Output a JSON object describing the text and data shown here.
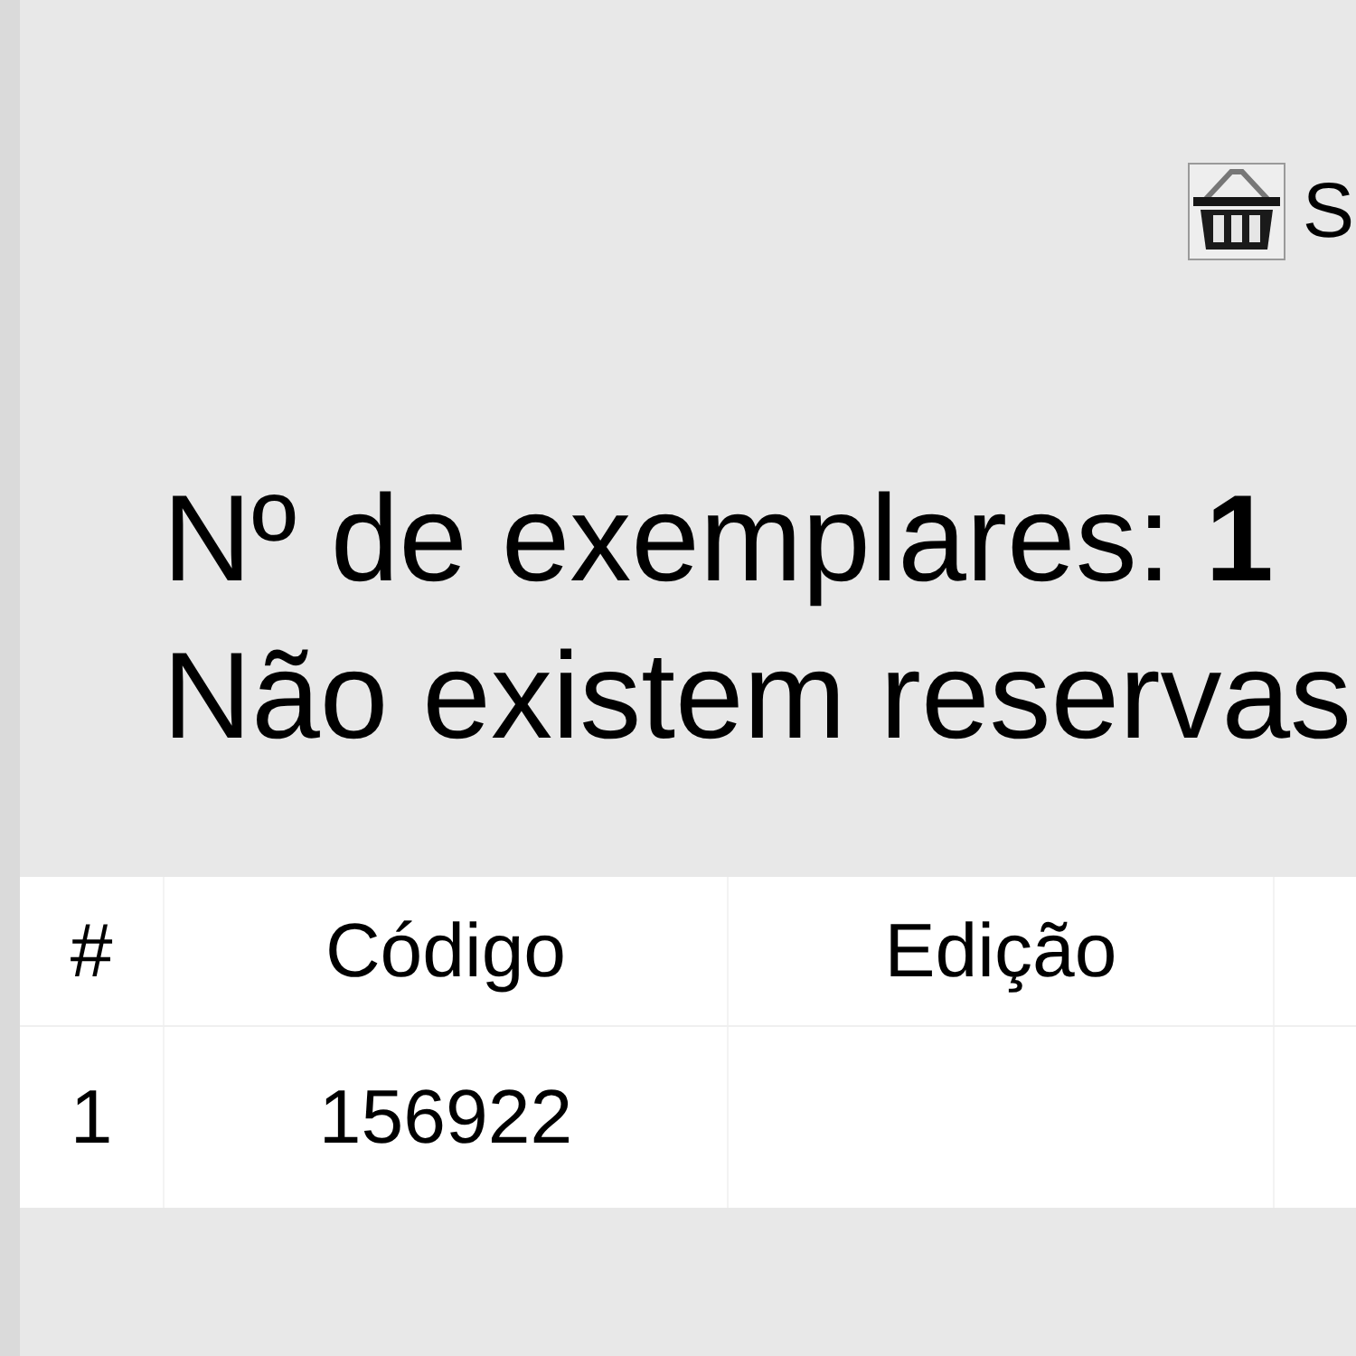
{
  "cart": {
    "label": "S"
  },
  "summary": {
    "copies": "Nº de exemplares: **1**",
    "reservations": "Não existem reservas"
  },
  "table": {
    "columns": [
      "#",
      "Código",
      "Edição"
    ],
    "rows": [
      {
        "number": "1",
        "code": "156922"
      }
    ]
  }
}
